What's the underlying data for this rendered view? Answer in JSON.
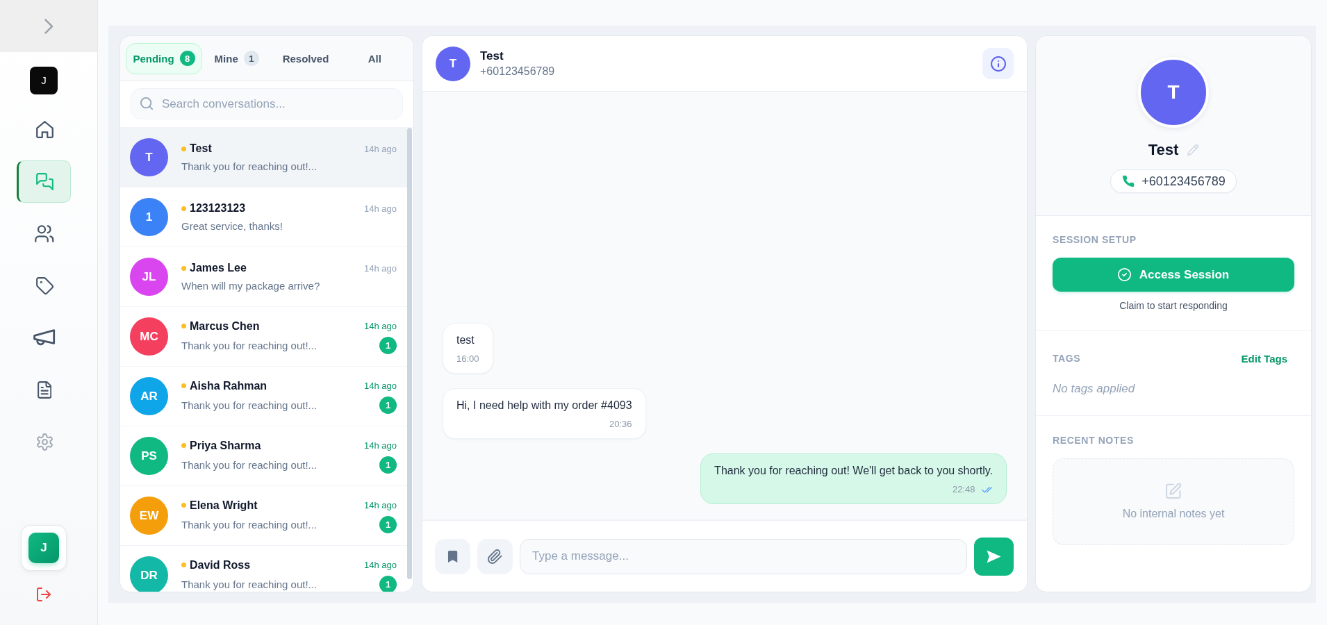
{
  "sidebar": {
    "logo": "J",
    "nav_items": [
      {
        "kind": "home",
        "selected": false,
        "disabled": false
      },
      {
        "kind": "chats",
        "selected": true,
        "disabled": false
      },
      {
        "kind": "contacts",
        "selected": false,
        "disabled": false
      },
      {
        "kind": "tags",
        "selected": false,
        "disabled": false
      },
      {
        "kind": "broadcasts",
        "selected": false,
        "disabled": false
      },
      {
        "kind": "documents",
        "selected": false,
        "disabled": false
      },
      {
        "kind": "settings",
        "selected": false,
        "disabled": true
      }
    ],
    "user": "J"
  },
  "conversations": {
    "tabs": [
      {
        "label": "Pending",
        "count": "8",
        "selected": true
      },
      {
        "label": "Mine",
        "count": "1",
        "selected": false
      },
      {
        "label": "Resolved",
        "selected": false
      },
      {
        "label": "All",
        "selected": false
      }
    ],
    "search": {
      "placeholder": "Search conversations..."
    },
    "items": [
      {
        "initials": "T",
        "color": "#6366f1",
        "name": "Test",
        "preview": "Thank you for reaching out!...",
        "time": "14h ago",
        "selected": true
      },
      {
        "initials": "1",
        "color": "#3b82f6",
        "name": "123123123",
        "preview": "Great service, thanks!",
        "time": "14h ago",
        "selected": false
      },
      {
        "initials": "JL",
        "color": "#d946ef",
        "name": "James Lee",
        "preview": "When will my package arrive?",
        "time": "14h ago",
        "selected": false
      },
      {
        "initials": "MC",
        "color": "#f43f5e",
        "name": "Marcus Chen",
        "preview": "Thank you for reaching out!...",
        "time": "14h ago",
        "unread": "1",
        "selected": false
      },
      {
        "initials": "AR",
        "color": "#0ea5e9",
        "name": "Aisha Rahman",
        "preview": "Thank you for reaching out!...",
        "time": "14h ago",
        "unread": "1",
        "selected": false
      },
      {
        "initials": "PS",
        "color": "#10b981",
        "name": "Priya Sharma",
        "preview": "Thank you for reaching out!...",
        "time": "14h ago",
        "unread": "1",
        "selected": false
      },
      {
        "initials": "EW",
        "color": "#f59e0b",
        "name": "Elena Wright",
        "preview": "Thank you for reaching out!...",
        "time": "14h ago",
        "unread": "1",
        "selected": false
      },
      {
        "initials": "DR",
        "color": "#14b8a6",
        "name": "David Ross",
        "preview": "Thank you for reaching out!...",
        "time": "14h ago",
        "unread": "1",
        "selected": false
      }
    ]
  },
  "chat": {
    "contact": {
      "initials": "T",
      "color": "#6366f1",
      "name": "Test",
      "phone": "+60123456789"
    },
    "messages": [
      {
        "kind": "incoming",
        "text": "test",
        "time": "16:00"
      },
      {
        "kind": "incoming",
        "text": "Hi, I need help with my order #4093",
        "time": "20:36"
      },
      {
        "kind": "outgoing",
        "text": "Thank you for reaching out! We'll get back to you shortly.",
        "time": "22:48"
      }
    ],
    "composer": {
      "placeholder": "Type a message..."
    }
  },
  "contact_panel": {
    "initials": "T",
    "color": "#6366f1",
    "name": "Test",
    "phone": "+60123456789",
    "session": {
      "title": "SESSION SETUP",
      "button": "Access Session",
      "hint": "Claim to start responding"
    },
    "tags": {
      "title": "TAGS",
      "action": "Edit Tags",
      "empty": "No tags applied"
    },
    "notes": {
      "title": "RECENT NOTES",
      "empty": "No internal notes yet"
    }
  }
}
